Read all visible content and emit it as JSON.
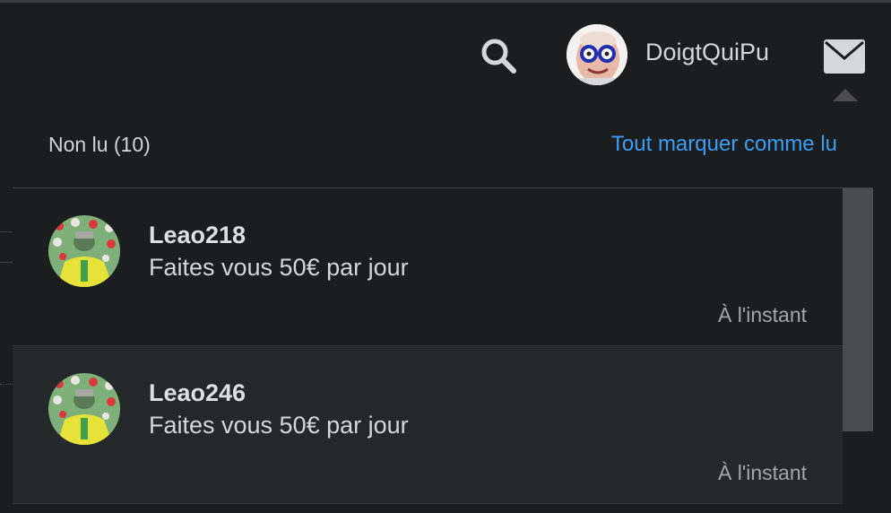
{
  "header": {
    "username": "DoigtQuiPu"
  },
  "notifications": {
    "unread_label": "Non lu (10)",
    "mark_all_label": "Tout marquer comme lu",
    "items": [
      {
        "sender": "Leao218",
        "message": "Faites vous 50€ par jour",
        "time": "À l'instant"
      },
      {
        "sender": "Leao246",
        "message": "Faites vous 50€ par jour",
        "time": "À l'instant"
      }
    ]
  },
  "colors": {
    "accent": "#3b9ef5",
    "background": "#1b1d1f",
    "item_alt_background": "#25282a"
  },
  "icons": [
    "search-icon",
    "mail-icon",
    "avatar"
  ]
}
